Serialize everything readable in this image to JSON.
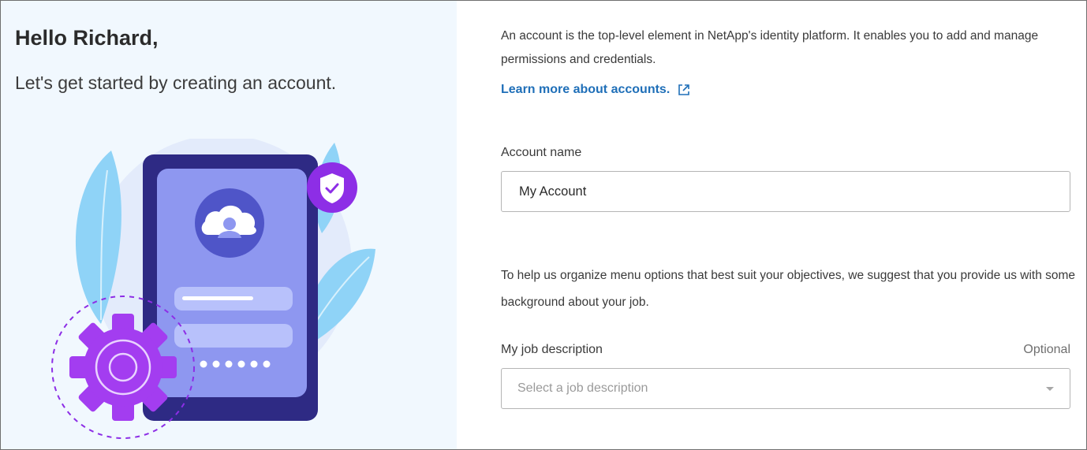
{
  "left": {
    "greeting": "Hello Richard,",
    "subtitle": "Let's get started by creating an account.",
    "illustration_icon": "account-security-illustration"
  },
  "right": {
    "intro": "An account is the top-level element in NetApp's identity platform. It enables you to add and manage permissions and credentials.",
    "learn_more_label": "Learn more about accounts.",
    "learn_more_icon": "external-link-icon",
    "account_name_label": "Account name",
    "account_name_value": "My Account",
    "help_text": "To help us organize menu options that best suit your objectives, we suggest that you provide us with some background about your job.",
    "job_label": "My job description",
    "optional_label": "Optional",
    "job_placeholder": "Select a job description",
    "job_caret_icon": "caret-down-icon"
  },
  "colors": {
    "left_background": "#f1f8fe",
    "link": "#1f6fb8",
    "phone_frame": "#2e2a84",
    "phone_screen": "#8e97f0",
    "accent_purple": "#8d2ee6",
    "leaf_blue": "#8fd3f7"
  }
}
